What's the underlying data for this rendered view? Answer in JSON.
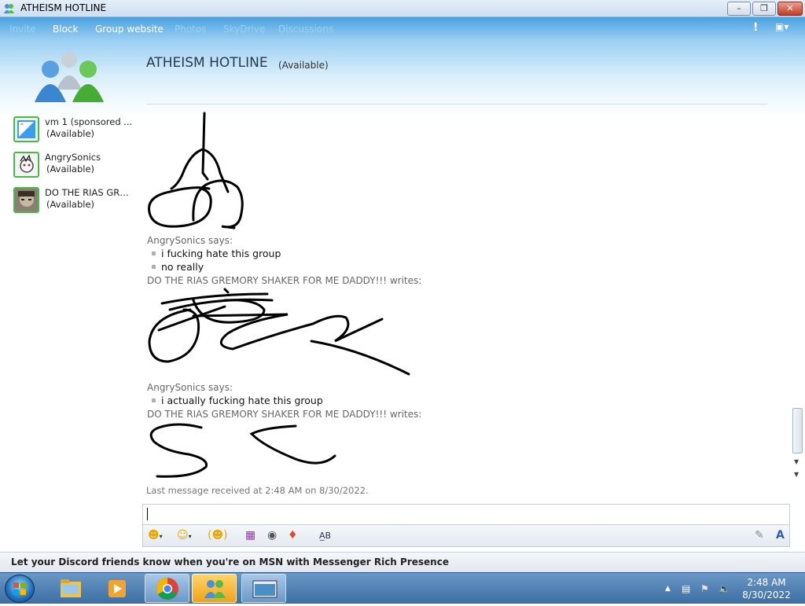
{
  "window": {
    "title": "ATHEISM HOTLINE"
  },
  "menubar": {
    "items": [
      {
        "label": "Invite",
        "enabled": false
      },
      {
        "label": "Block",
        "enabled": true
      },
      {
        "label": "Group website",
        "enabled": true
      },
      {
        "label": "Photos",
        "enabled": false
      },
      {
        "label": "SkyDrive",
        "enabled": false
      },
      {
        "label": "Discussions",
        "enabled": false
      }
    ],
    "alert_label": "!"
  },
  "conversation": {
    "title": "ATHEISM HOTLINE",
    "status": "(Available)"
  },
  "contacts": [
    {
      "name": "vm 1 (sponsored ...",
      "status": "(Available)"
    },
    {
      "name": "AngrySonics",
      "status": "(Available)"
    },
    {
      "name": "DO THE RIAS GRE...",
      "status": "(Available)"
    }
  ],
  "messages": {
    "sender1": "AngrySonics says:",
    "lines1": [
      "i fucking hate this group",
      "no really"
    ],
    "sender2": "DO THE RIAS GREMORY SHAKER FOR ME DADDY!!! writes:",
    "sender3": "AngrySonics says:",
    "lines3": [
      "i actually fucking hate this group"
    ],
    "sender4": "DO THE RIAS GREMORY SHAKER FOR ME DADDY!!! writes:",
    "last_received": "Last message received at 2:48 AM on 8/30/2022."
  },
  "input": {
    "value": ""
  },
  "ad": {
    "text": "Let your Discord friends know when you're on MSN with Messenger Rich Presence"
  },
  "taskbar": {
    "time": "2:48 AM",
    "date": "8/30/2022"
  },
  "colors": {
    "accent": "#4aa1e0",
    "online": "#4ab84a"
  }
}
